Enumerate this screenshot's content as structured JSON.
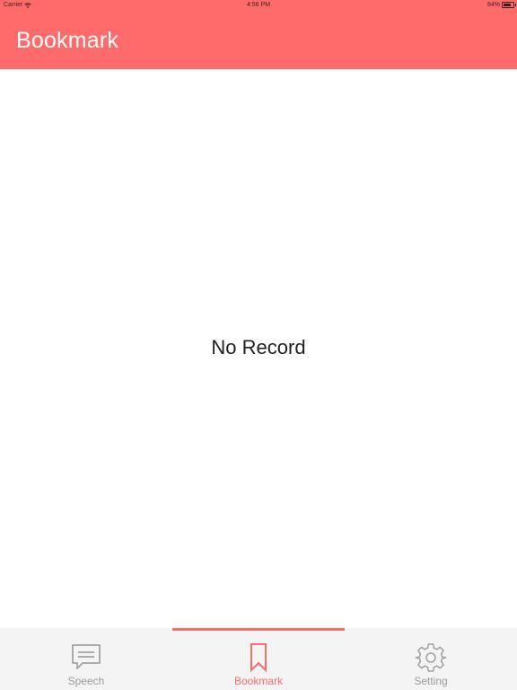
{
  "status_bar": {
    "carrier": "Carrier",
    "time": "4:56 PM",
    "battery": "84%"
  },
  "header": {
    "title": "Bookmark"
  },
  "main": {
    "empty_message": "No Record"
  },
  "tab_bar": {
    "tabs": [
      {
        "label": "Speech",
        "icon": "speech-bubble-icon",
        "active": false
      },
      {
        "label": "Bookmark",
        "icon": "bookmark-icon",
        "active": true
      },
      {
        "label": "Setting",
        "icon": "gear-icon",
        "active": false
      }
    ]
  },
  "colors": {
    "accent": "#ff6b6b",
    "tab_inactive": "#9a9a9a",
    "tab_bar_background": "#f4f4f4"
  }
}
